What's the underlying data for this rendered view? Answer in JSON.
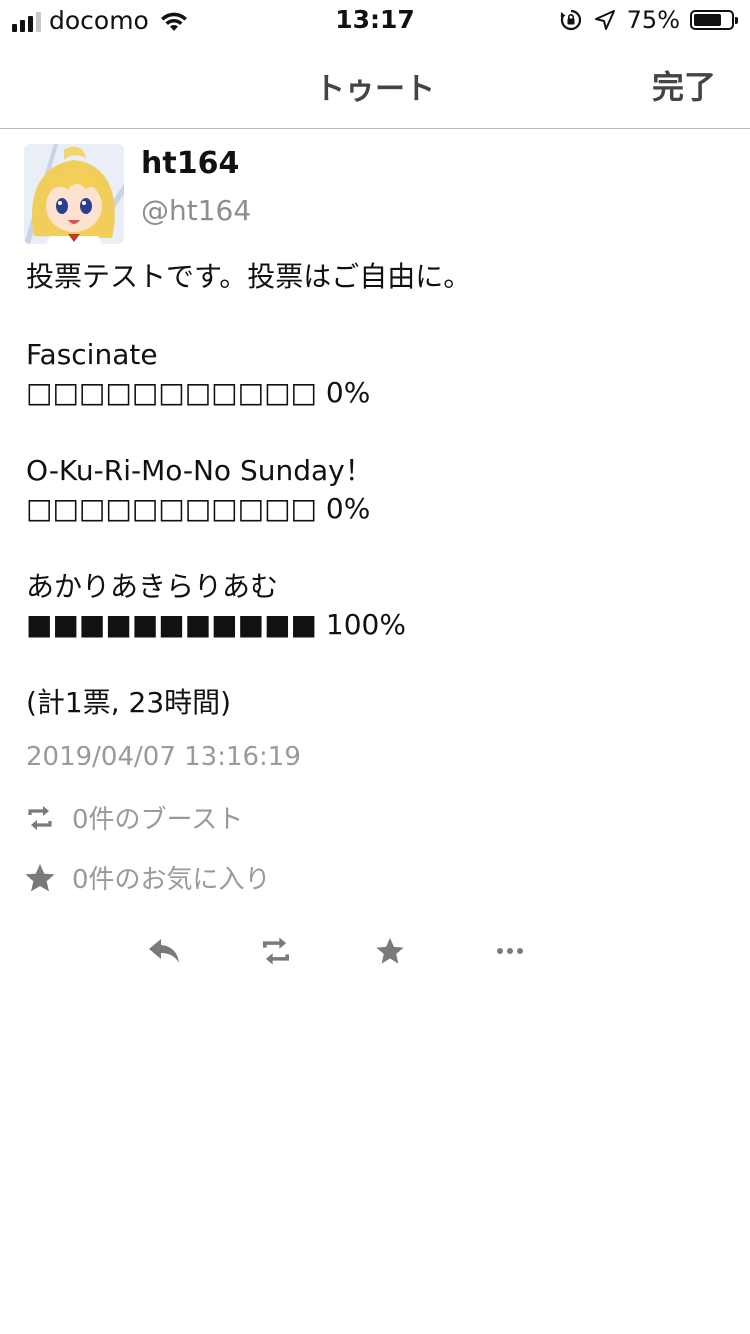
{
  "status_bar": {
    "carrier": "docomo",
    "time": "13:17",
    "battery_percent": "75%",
    "battery_level": 0.75,
    "icons": [
      "signal-icon",
      "wifi-icon",
      "orientation-lock-icon",
      "location-icon",
      "battery-icon"
    ]
  },
  "nav": {
    "title": "トゥート",
    "done_label": "完了"
  },
  "toot": {
    "display_name": "ht164",
    "acct": "@ht164",
    "lines": [
      "投票テストです。投票はご自由に。",
      "",
      "Fascinate",
      "□□□□□□□□□□□ 0%",
      "",
      "O-Ku-Ri-Mo-No Sunday！",
      "□□□□□□□□□□□ 0%",
      "",
      "あかりあきらりあむ",
      "■■■■■■■■■■■ 100%",
      "",
      "(計1票, 23時間)"
    ],
    "timestamp": "2019/04/07 13:16:19",
    "boost_count_text": "0件のブースト",
    "favourite_count_text": "0件のお気に入り"
  },
  "actions": {
    "icons": [
      "reply-icon",
      "boost-icon",
      "favourite-icon",
      "more-icon"
    ]
  },
  "colors": {
    "text": "#111111",
    "secondary": "#9a9a9a",
    "nav_text": "#444444",
    "icon": "#7a7a7a"
  }
}
